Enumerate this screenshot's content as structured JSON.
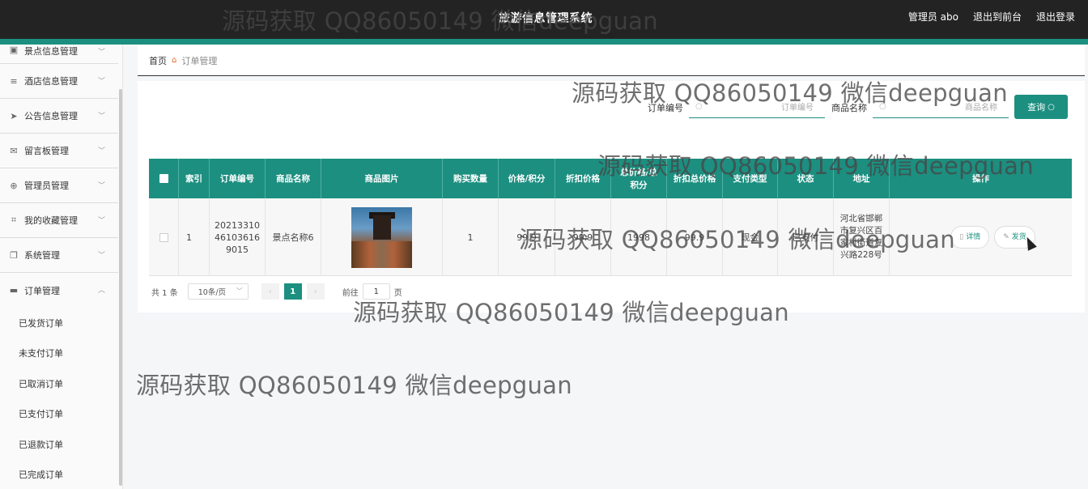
{
  "header": {
    "title": "旅游信息管理系统",
    "user": "管理员 abo",
    "to_front": "退出到前台",
    "logout": "退出登录"
  },
  "sidebar": {
    "items": [
      {
        "label": "景点信息管理",
        "icon": "clipboard-icon",
        "glyph": "▣",
        "chevron": "﹀"
      },
      {
        "label": "酒店信息管理",
        "icon": "list-icon",
        "glyph": "≡",
        "chevron": "﹀"
      },
      {
        "label": "公告信息管理",
        "icon": "send-icon",
        "glyph": "➤",
        "chevron": "﹀"
      },
      {
        "label": "留言板管理",
        "icon": "mail-icon",
        "glyph": "✉",
        "chevron": "﹀"
      },
      {
        "label": "管理员管理",
        "icon": "compass-icon",
        "glyph": "⊕",
        "chevron": "﹀"
      },
      {
        "label": "我的收藏管理",
        "icon": "crop-icon",
        "glyph": "⌗",
        "chevron": "﹀"
      },
      {
        "label": "系统管理",
        "icon": "copy-icon",
        "glyph": "❐",
        "chevron": "﹀"
      },
      {
        "label": "订单管理",
        "icon": "cart-icon",
        "glyph": "▬",
        "chevron": "︿"
      }
    ],
    "subitems": [
      "已发货订单",
      "未支付订单",
      "已取消订单",
      "已支付订单",
      "已退款订单",
      "已完成订单"
    ]
  },
  "breadcrumb": {
    "home": "首页",
    "sep_icon": "home-icon",
    "current": "订单管理"
  },
  "search": {
    "order_label": "订单编号",
    "order_placeholder": "订单编号",
    "product_label": "商品名称",
    "product_placeholder": "商品名称",
    "query_button": "查询"
  },
  "table": {
    "headers": [
      "索引",
      "订单编号",
      "商品名称",
      "商品图片",
      "购买数量",
      "价格/积分",
      "折扣价格",
      "总价格/总积分",
      "折扣总价格",
      "支付类型",
      "状态",
      "地址",
      "操作"
    ],
    "rows": [
      {
        "index": "1",
        "order_no": "20213310 46103616 9015",
        "product": "景点名称6",
        "quantity": "1",
        "price": "99.9",
        "discount_price": "99.9",
        "total": "1998",
        "discount_total": "99.9",
        "pay_type": "现金",
        "status": "已支付",
        "address": "河北省邯郸市复兴区百家村街道复兴路228号",
        "detail_btn": "详情",
        "ship_btn": "发货"
      }
    ]
  },
  "pagination": {
    "total": "共 1 条",
    "page_size": "10条/页",
    "current_page": "1",
    "goto_label": "前往",
    "goto_value": "1",
    "page_suffix": "页"
  },
  "watermark": "源码获取 QQ86050149 微信deepguan",
  "colors": {
    "accent": "#1c8f80",
    "header": "#232323"
  }
}
